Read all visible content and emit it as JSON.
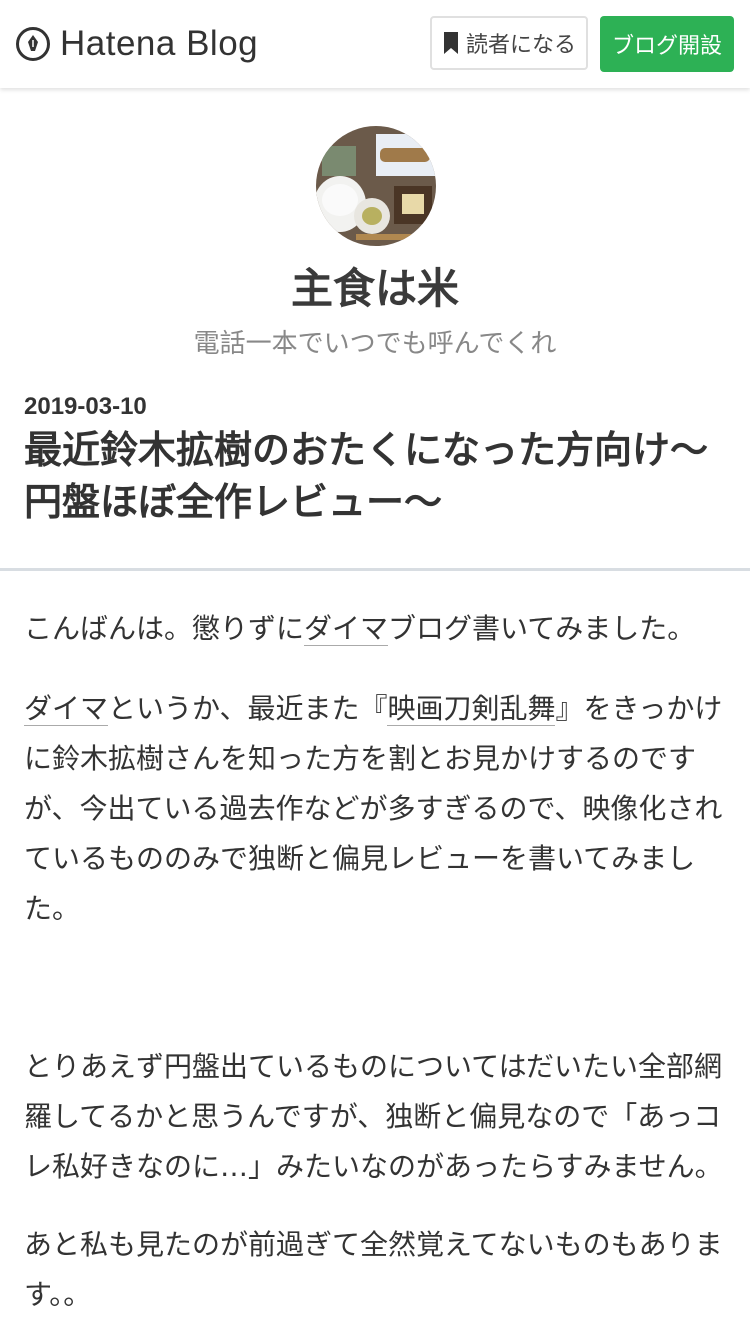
{
  "header": {
    "logo_text": "Hatena Blog",
    "subscribe_label": "読者になる",
    "open_blog_label": "ブログ開設"
  },
  "blog": {
    "title": "主食は米",
    "description": "電話一本でいつでも呼んでくれ"
  },
  "entry": {
    "date": "2019-03-10",
    "title": "最近鈴木拡樹のおたくになった方向け〜円盤ほぼ全作レビュー〜",
    "p1": {
      "before": "こんばんは。懲りずに",
      "link": "ダイマ",
      "after": "ブログ書いてみました。"
    },
    "p2": {
      "link1": "ダイマ",
      "text1": "というか、最近また『",
      "link2": "映画刀剣乱舞",
      "text2": "』をきっかけに鈴木拡樹さんを知った方を割とお見かけするのですが、今出ている過去作などが多すぎるので、映像化されているもののみで独断と偏見レビューを書いてみました。"
    },
    "p3": "とりあえず円盤出ているものについてはだいたい全部網羅してるかと思うんですが、独断と偏見なので「あっコレ私好きなのに…」みたいなのがあったらすみません。",
    "p4": "あと私も見たのが前過ぎて全然覚えてないものもあります。。"
  },
  "colors": {
    "accent_green": "#2db155",
    "text": "#333333",
    "muted": "#888888"
  },
  "icons": {
    "logo": "hatena-pen-icon",
    "subscribe": "bookmark-icon"
  }
}
